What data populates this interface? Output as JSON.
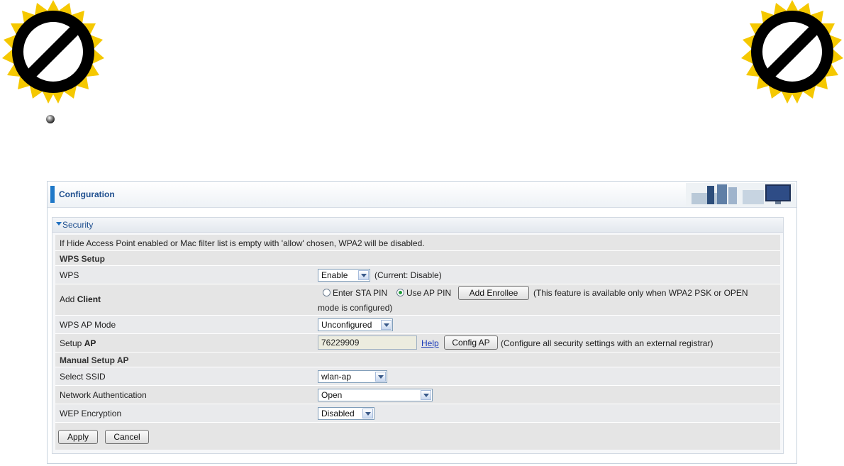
{
  "page": {
    "title": "Configuration",
    "section_title": "Security"
  },
  "notice": "If Hide Access Point enabled or Mac filter list is empty with 'allow' chosen, WPA2 will be disabled.",
  "wps_setup": {
    "heading": "WPS Setup",
    "wps_label": "WPS",
    "wps_value": "Enable",
    "wps_current": "(Current: Disable)",
    "add_client_label_prefix": "Add ",
    "add_client_label_bold": "Client",
    "radio_sta_pin": "Enter STA PIN",
    "radio_ap_pin": "Use AP PIN",
    "selected_radio": "Use AP PIN",
    "add_enrollee_button": "Add Enrollee",
    "add_client_note_line1": "(This feature is available only when WPA2 PSK or OPEN",
    "add_client_note_line2": "mode is configured)",
    "ap_mode_label": "WPS AP Mode",
    "ap_mode_value": "Unconfigured",
    "setup_ap_label_prefix": "Setup ",
    "setup_ap_label_bold": "AP",
    "setup_ap_pin": "76229909",
    "help_link": "Help",
    "config_ap_button": "Config AP",
    "config_ap_note": "(Configure all security settings with an external registrar)"
  },
  "manual_setup": {
    "heading": "Manual Setup AP",
    "ssid_label": "Select SSID",
    "ssid_value": "wlan-ap",
    "auth_label": "Network Authentication",
    "auth_value": "Open",
    "wep_label": "WEP Encryption",
    "wep_value": "Disabled"
  },
  "actions": {
    "apply": "Apply",
    "cancel": "Cancel"
  },
  "icons": {
    "corner_badges": "prohibited-sign-icon",
    "bullet": "sphere-bullet-icon",
    "header_art": "office-banner-icon"
  },
  "colors": {
    "accent": "#1f78c8",
    "badge_fill": "#f5c800",
    "link": "#1a3ab8"
  }
}
